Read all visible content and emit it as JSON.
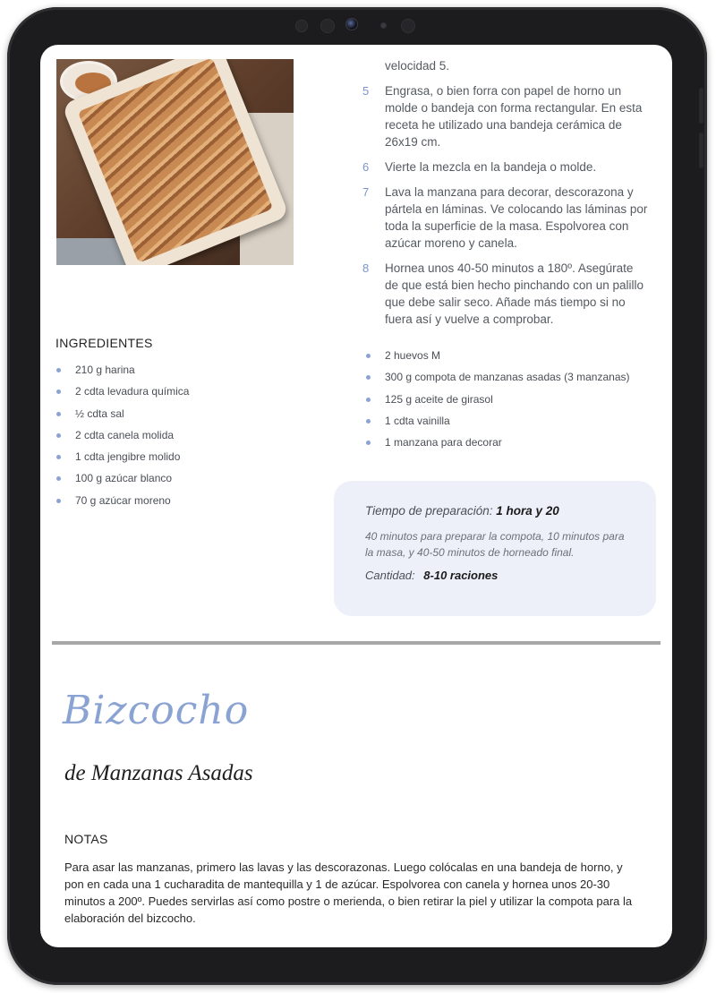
{
  "recipe": {
    "steps_continued": "velocidad 5.",
    "steps": [
      {
        "num": "5",
        "text": "Engrasa, o bien forra con papel de horno un molde o bandeja con forma rectangular. En esta receta he utilizado una bandeja cerámica de 26x19 cm."
      },
      {
        "num": "6",
        "text": "Vierte la mezcla en la bandeja o molde."
      },
      {
        "num": "7",
        "text": "Lava la manzana para decorar, descorazona y pártela en láminas. Ve colocando las láminas por toda la superficie de la masa. Espolvorea con azúcar moreno y canela."
      },
      {
        "num": "8",
        "text": "Hornea unos 40-50 minutos a 180º. Asegúrate de que está bien hecho pinchando con un palillo que debe salir seco. Añade más tiempo si no fuera así y vuelve a comprobar."
      }
    ],
    "ingredients_title": "INGREDIENTES",
    "ingredients_left": [
      "210 g harina",
      "2 cdta levadura química",
      "½ cdta sal",
      "2 cdta canela molida",
      "1 cdta jengibre molido",
      "100 g azúcar blanco",
      "70 g azúcar moreno"
    ],
    "ingredients_right": [
      "2 huevos M",
      "300 g compota de manzanas asadas (3 manzanas)",
      "125 g aceite de girasol",
      "1 cdta vainilla",
      "1 manzana para decorar"
    ],
    "info": {
      "prep_label": "Tiempo de preparación:",
      "prep_value": "1 hora y 20",
      "prep_note": "40 minutos para preparar la compota, 10 minutos para la masa, y 40-50 minutos de horneado final.",
      "qty_label": "Cantidad:",
      "qty_value": "8-10 raciones"
    },
    "title_script": "Bizcocho",
    "title_sub": "de Manzanas Asadas",
    "notes_title": "NOTAS",
    "notes_text": "Para asar las manzanas, primero las lavas y las descorazonas. Luego colócalas en una bandeja de horno, y pon en cada una 1 cucharadita de mantequilla y 1 de azúcar. Espolvorea con canela y hornea unos 20-30 minutos a 200º. Puedes servirlas así como postre o merienda, o bien retirar la piel y utilizar la compota para la elaboración del bizcocho."
  },
  "colors": {
    "accent": "#8aa3d3",
    "step_number": "#7b95c9",
    "info_box_bg": "#eef0f9",
    "divider": "#a7a7a7",
    "device_frame": "#1c1c1e"
  },
  "icons": {
    "camera": "front-camera-icon",
    "bullet": "bullet-dot-icon"
  }
}
